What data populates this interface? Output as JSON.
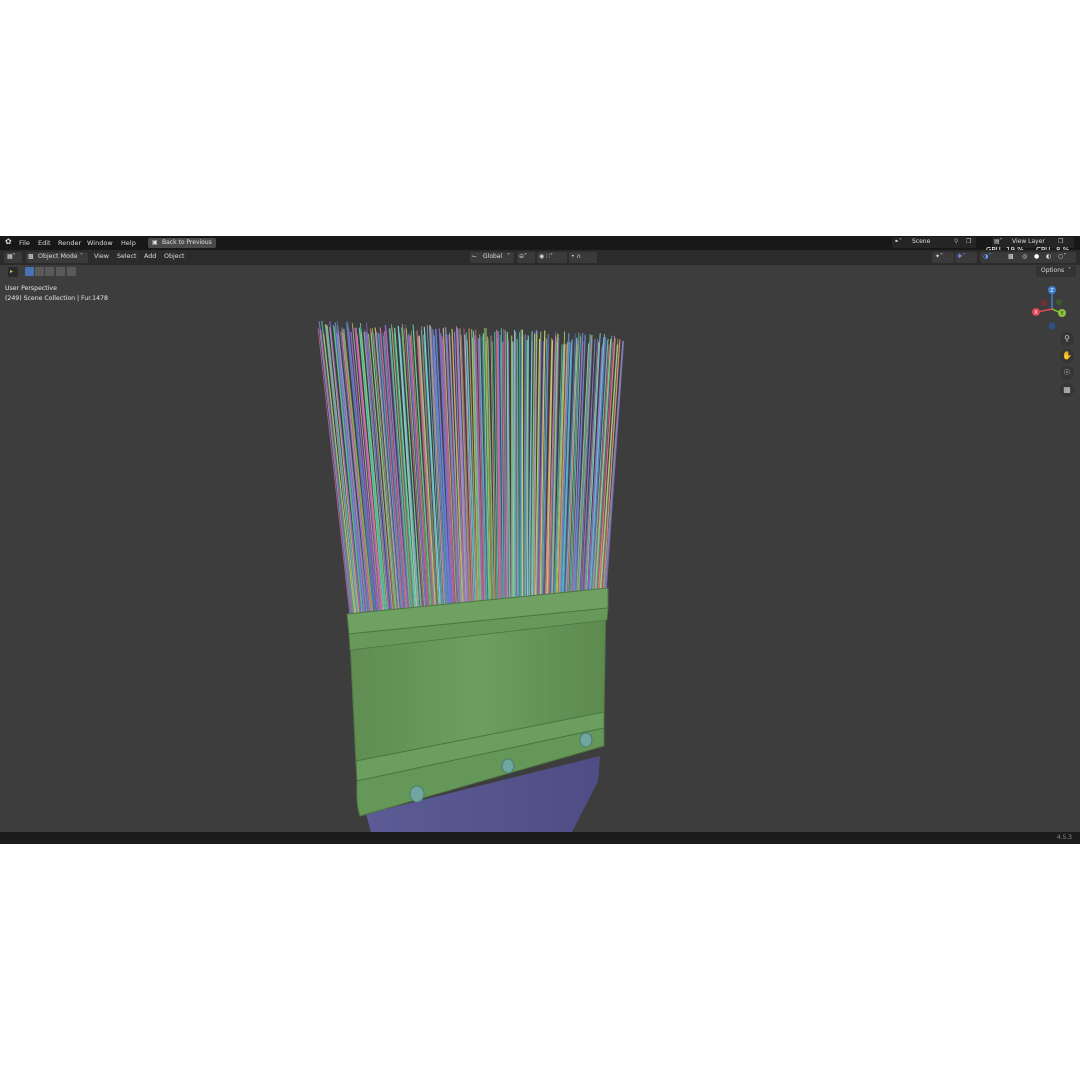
{
  "menu": {
    "items": [
      "File",
      "Edit",
      "Render",
      "Window",
      "Help"
    ],
    "back_button": "Back to Previous",
    "scene_label": "Scene",
    "viewlayer_label": "View Layer",
    "gpu_label": "GPU",
    "gpu_value": "19 %",
    "cpu_label": "CPU",
    "cpu_value": "8 %"
  },
  "header": {
    "mode": "Object Mode",
    "menus": [
      "View",
      "Select",
      "Add",
      "Object"
    ],
    "transform_orientation": "Global",
    "options_label": "Options"
  },
  "viewport": {
    "perspective": "User Perspective",
    "collection_info": "(249) Scene Collection | Fur.1478"
  },
  "gizmo": {
    "x": "X",
    "y": "Y",
    "z": "Z",
    "x_color": "#e04758",
    "y_color": "#8ac23a",
    "z_color": "#3f7fd6"
  },
  "status": {
    "version": "4.5.3"
  },
  "colors": {
    "background": "#3d3d3d",
    "ferrule": "#6a9a5a",
    "handle": "#5b5a92",
    "accent": "#4772b3"
  }
}
